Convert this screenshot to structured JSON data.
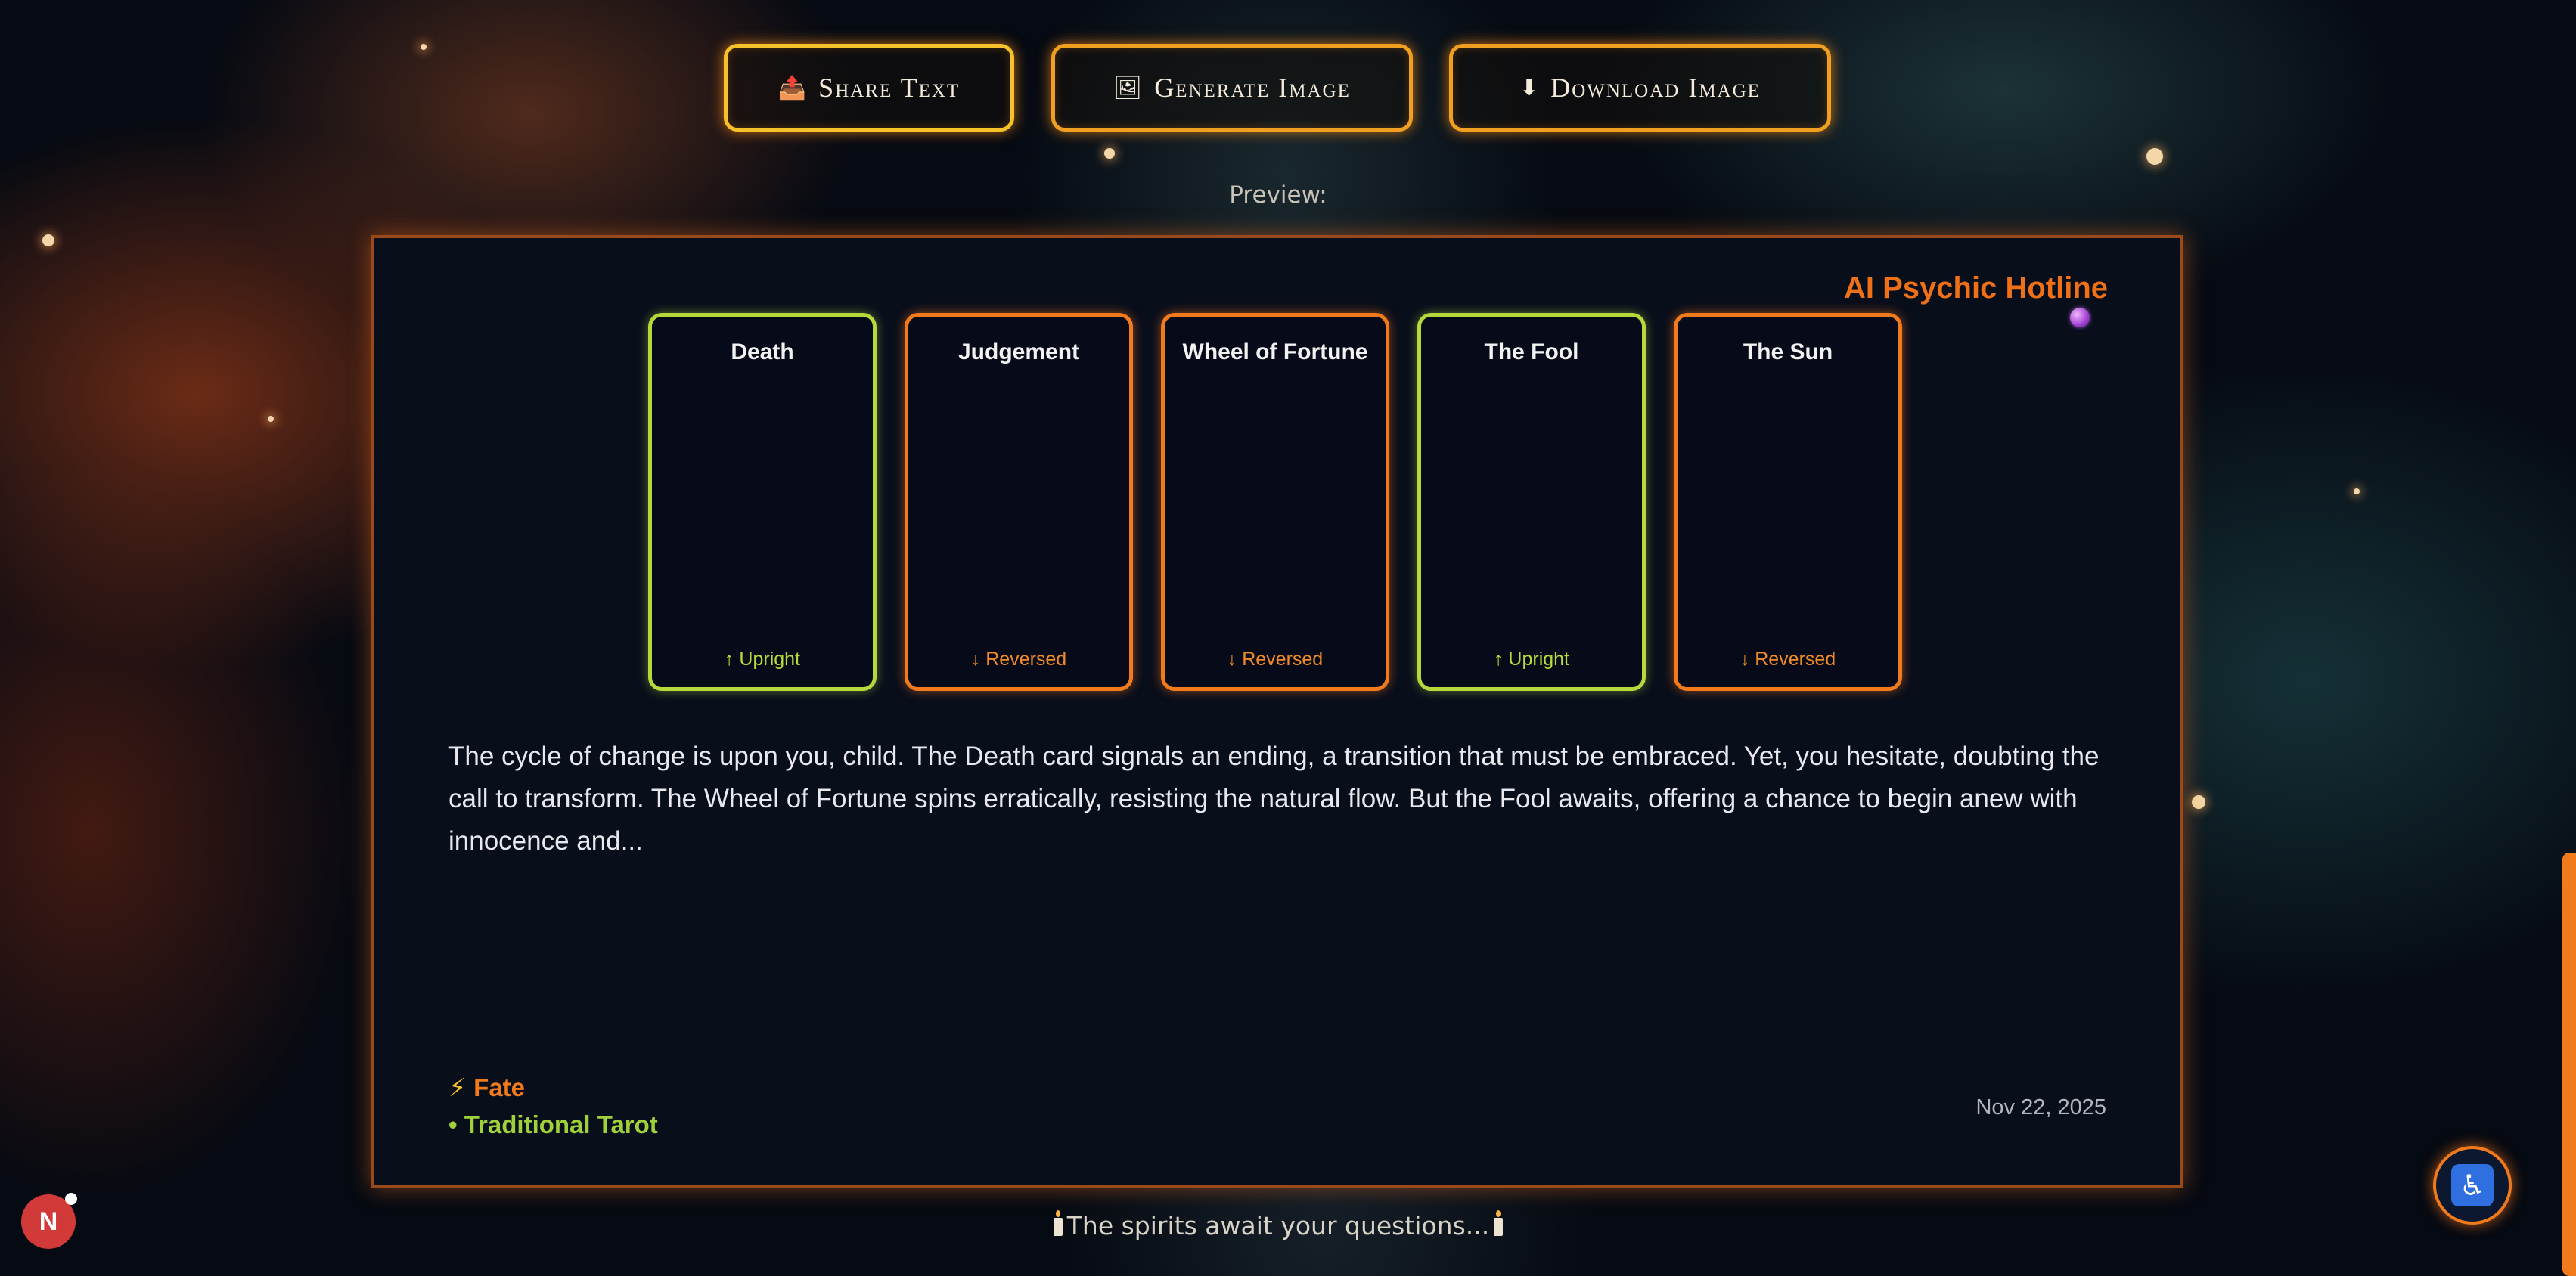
{
  "actions": {
    "share": {
      "icon": "📤",
      "label": "Share Text"
    },
    "generate": {
      "icon": "🖼",
      "label": "Generate Image"
    },
    "download": {
      "icon": "⬇",
      "label": "Download Image"
    }
  },
  "preview_label": "Preview:",
  "panel": {
    "brand": "AI Psychic Hotline",
    "brand_icon": "crystal-ball-icon",
    "cards": [
      {
        "name": "Death",
        "orientation": "↑ Upright",
        "state": "upright"
      },
      {
        "name": "Judgement",
        "orientation": "↓ Reversed",
        "state": "reversed"
      },
      {
        "name": "Wheel of Fortune",
        "orientation": "↓ Reversed",
        "state": "reversed"
      },
      {
        "name": "The Fool",
        "orientation": "↑ Upright",
        "state": "upright"
      },
      {
        "name": "The Sun",
        "orientation": "↓ Reversed",
        "state": "reversed"
      }
    ],
    "reading": "The cycle of change is upon you, child. The Death card signals an ending, a transition that must be embraced. Yet, you hesitate, doubting the call to transform. The Wheel of Fortune spins erratically, resisting the natural flow. But the Fool awaits, offering a chance to begin anew with innocence and...",
    "category": {
      "icon": "⚡",
      "label": "Fate"
    },
    "deck": "• Traditional Tarot",
    "date": "Nov 22, 2025"
  },
  "footer": {
    "text": "The spirits await your questions..."
  },
  "avatar": {
    "letter": "N"
  },
  "accessibility": {
    "icon": "♿"
  },
  "colors": {
    "accent_orange": "#f07a1c",
    "accent_green": "#b6d83a",
    "accent_gold": "#f5c22a"
  }
}
